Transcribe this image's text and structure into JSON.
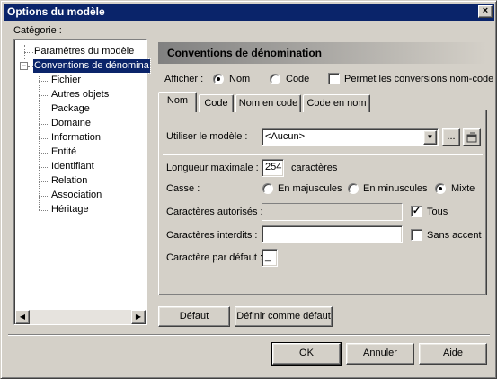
{
  "window": {
    "title": "Options du modèle"
  },
  "category": {
    "label": "Catégorie :",
    "tree": [
      {
        "label": "Paramètres du modèle",
        "selected": false
      },
      {
        "label": "Conventions de dénomina",
        "selected": true
      },
      {
        "label": "Fichier"
      },
      {
        "label": "Autres objets"
      },
      {
        "label": "Package"
      },
      {
        "label": "Domaine"
      },
      {
        "label": "Information"
      },
      {
        "label": "Entité"
      },
      {
        "label": "Identifiant"
      },
      {
        "label": "Relation"
      },
      {
        "label": "Association"
      },
      {
        "label": "Héritage"
      }
    ]
  },
  "panel": {
    "title": "Conventions de dénomination",
    "afficher": {
      "label": "Afficher :",
      "options": [
        {
          "label": "Nom",
          "checked": true
        },
        {
          "label": "Code",
          "checked": false
        }
      ],
      "permit_label": "Permet les conversions nom-code",
      "permit_checked": false
    },
    "tabs": [
      {
        "label": "Nom",
        "active": true
      },
      {
        "label": "Code",
        "active": false
      },
      {
        "label": "Nom en code",
        "active": false
      },
      {
        "label": "Code en nom",
        "active": false
      }
    ],
    "template": {
      "label": "Utiliser le modèle :",
      "value": "<Aucun>",
      "ellipsis": "..."
    },
    "max_length": {
      "label": "Longueur maximale :",
      "value": "254",
      "unit": "caractères"
    },
    "casse": {
      "label": "Casse :",
      "options": [
        {
          "label": "En majuscules",
          "checked": false
        },
        {
          "label": "En minuscules",
          "checked": false
        },
        {
          "label": "Mixte",
          "checked": true
        }
      ]
    },
    "allowed_chars": {
      "label": "Caractères autorisés :",
      "value": "",
      "all_label": "Tous",
      "all_checked": true
    },
    "forbidden_chars": {
      "label": "Caractères interdits :",
      "value": "",
      "no_accent_label": "Sans accent",
      "no_accent_checked": false
    },
    "default_char": {
      "label": "Caractère par défaut :",
      "value": "_"
    }
  },
  "buttons": {
    "default": "Défaut",
    "set_default": "Définir comme défaut",
    "ok": "OK",
    "cancel": "Annuler",
    "help": "Aide"
  }
}
